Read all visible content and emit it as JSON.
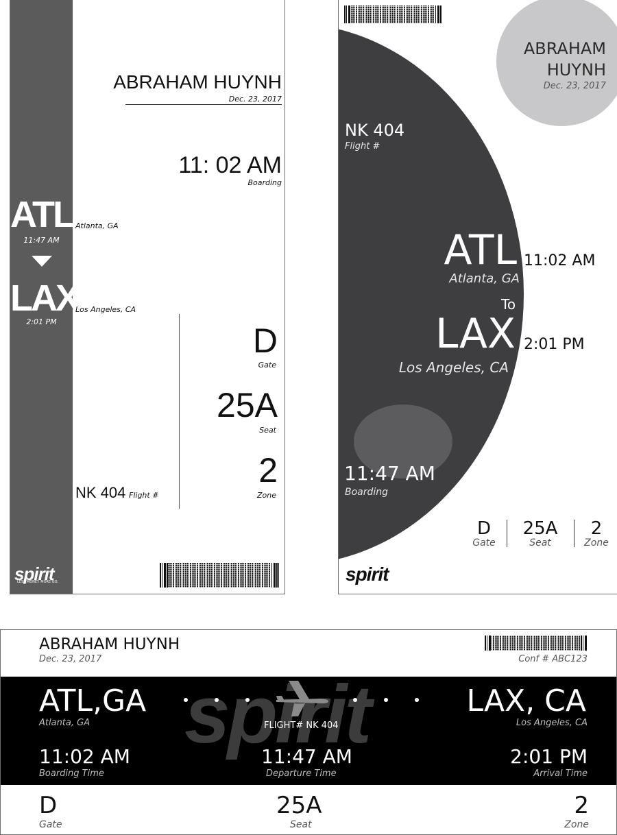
{
  "pass1": {
    "name": "ABRAHAM HUYNH",
    "date": "Dec. 23, 2017",
    "boarding_time": "11: 02 AM",
    "boarding_label": "Boarding",
    "origin_code": "ATL",
    "origin_time": "11:47 AM",
    "origin_city": "Atlanta, GA",
    "dest_code": "LAX",
    "dest_time": "2:01 PM",
    "dest_city": "Los Angeles, CA",
    "gate": "D",
    "gate_label": "Gate",
    "seat": "25A",
    "seat_label": "Seat",
    "zone": "2",
    "zone_label": "Zone",
    "flight": "NK 404",
    "flight_label": "Flight #",
    "logo": "spirit",
    "tagline": "LESS MONEY. MORE GO."
  },
  "pass2": {
    "name_line1": "ABRAHAM",
    "name_line2": "HUYNH",
    "date": "Dec. 23, 2017",
    "flight": "NK 404",
    "flight_label": "Flight #",
    "origin_code": "ATL",
    "origin_city": "Atlanta, GA",
    "origin_time": "11:02 AM",
    "to_label": "To",
    "dest_code": "LAX",
    "dest_city": "Los Angeles, CA",
    "dest_time": "2:01 PM",
    "boarding_time": "11:47 AM",
    "boarding_label": "Boarding",
    "gate": "D",
    "gate_label": "Gate",
    "seat": "25A",
    "seat_label": "Seat",
    "zone": "2",
    "zone_label": "Zone",
    "logo": "spirit"
  },
  "pass3": {
    "name": "ABRAHAM HUYNH",
    "date": "Dec. 23, 2017",
    "conf": "Conf # ABC123",
    "origin": "ATL,GA",
    "origin_city": "Atlanta, GA",
    "dest": "LAX, CA",
    "dest_city": "Los Angeles, CA",
    "flight": "FLIGHT# NK 404",
    "watermark": "spirit",
    "boarding_time": "11:02 AM",
    "boarding_label": "Boarding Time",
    "departure_time": "11:47 AM",
    "departure_label": "Departure Time",
    "arrival_time": "2:01 PM",
    "arrival_label": "Arrival Time",
    "gate": "D",
    "gate_label": "Gate",
    "seat": "25A",
    "seat_label": "Seat",
    "zone": "2",
    "zone_label": "Zone"
  },
  "colors": {
    "band_gray": "#5b5b5b",
    "circle_dark": "#3e3e40",
    "circle_light": "#c8c8ca",
    "band_black": "#000000"
  },
  "icons": [
    "down-triangle-icon",
    "airplane-icon",
    "barcode-icon"
  ]
}
